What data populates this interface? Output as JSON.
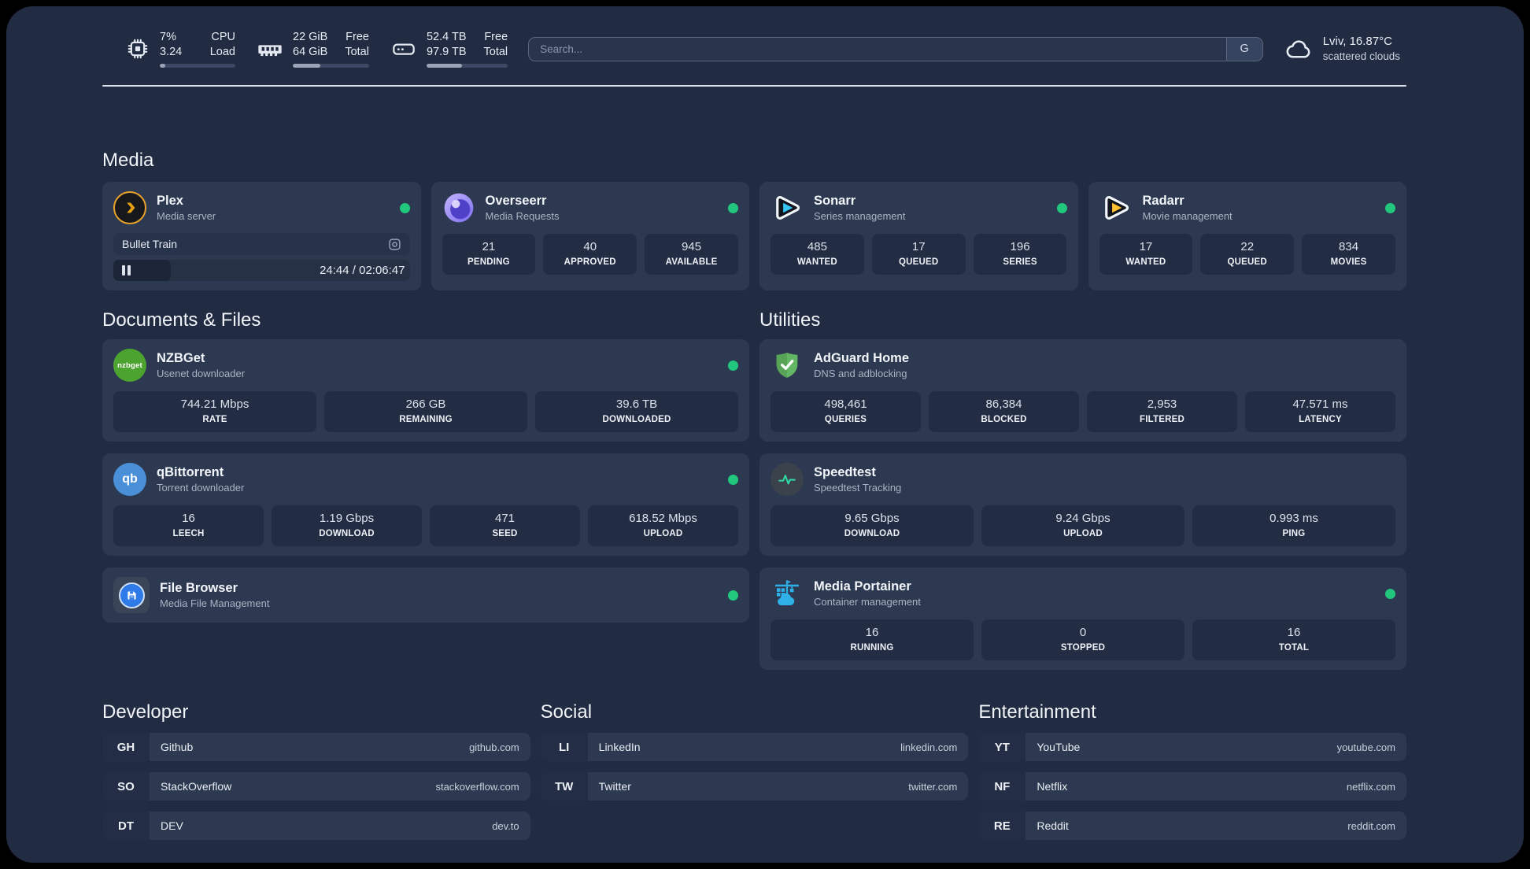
{
  "colors": {
    "page_bg": "#212b42",
    "card_bg": "#2c3950",
    "tile_bg": "#222c42",
    "status_online": "#21c77d",
    "plex_accent": "#e5a00d",
    "sonarr_accent": "#35c5f1",
    "radarr_accent": "#ffc230",
    "nzbget_accent": "#4da32f",
    "qbittorrent_accent": "#4a90d9",
    "filebrowser_accent": "#2e7ae8",
    "adguard_accent": "#63b663",
    "speedtest_accent": "#2ed9a3",
    "portainer_accent": "#2fb1e8"
  },
  "icons": {
    "cpu": "cpu-chip-icon",
    "memory": "ram-icon",
    "disk": "hard-drive-icon",
    "search_engine": "google-g",
    "weather": "cloud-icon",
    "plex": "plex-chevron-circle",
    "plex_session": "cast-icon",
    "plex_state": "pause-icon",
    "overseerr": "overseerr-eye-circle",
    "sonarr": "sonarr-play-triangle",
    "radarr": "radarr-play-triangle",
    "nzbget": "nzbget-green-circle",
    "qbittorrent": "qbittorrent-blue-circle",
    "filebrowser": "filebrowser-floppy-circle",
    "adguard": "adguard-shield-check",
    "speedtest": "speedtest-pulse",
    "portainer": "portainer-crane",
    "status": "online-dot"
  },
  "topbar": {
    "cpu": {
      "value_primary": "7%",
      "value_secondary": "3.24",
      "label_primary": "CPU",
      "label_secondary": "Load",
      "progress_percent": 7
    },
    "memory": {
      "value_primary": "22 GiB",
      "value_secondary": "64 GiB",
      "label_primary": "Free",
      "label_secondary": "Total",
      "progress_percent": 36
    },
    "disk": {
      "value_primary": "52.4 TB",
      "value_secondary": "97.9 TB",
      "label_primary": "Free",
      "label_secondary": "Total",
      "progress_percent": 44
    },
    "search": {
      "placeholder": "Search...",
      "button_label": "G"
    },
    "weather": {
      "location": "Lviv, 16.87°C",
      "condition": "scattered clouds"
    }
  },
  "media": {
    "title": "Media",
    "plex": {
      "name": "Plex",
      "subtitle": "Media server",
      "status": "online",
      "now_playing": {
        "title": "Bullet Train",
        "time": "24:44 / 02:06:47",
        "progress_percent": 19.5,
        "state": "paused"
      }
    },
    "overseerr": {
      "name": "Overseerr",
      "subtitle": "Media Requests",
      "status": "online",
      "stats": [
        {
          "value": "21",
          "label": "PENDING"
        },
        {
          "value": "40",
          "label": "APPROVED"
        },
        {
          "value": "945",
          "label": "AVAILABLE"
        }
      ]
    },
    "sonarr": {
      "name": "Sonarr",
      "subtitle": "Series management",
      "status": "online",
      "stats": [
        {
          "value": "485",
          "label": "WANTED"
        },
        {
          "value": "17",
          "label": "QUEUED"
        },
        {
          "value": "196",
          "label": "SERIES"
        }
      ]
    },
    "radarr": {
      "name": "Radarr",
      "subtitle": "Movie management",
      "status": "online",
      "stats": [
        {
          "value": "17",
          "label": "WANTED"
        },
        {
          "value": "22",
          "label": "QUEUED"
        },
        {
          "value": "834",
          "label": "MOVIES"
        }
      ]
    }
  },
  "documents": {
    "title": "Documents & Files",
    "nzbget": {
      "name": "NZBGet",
      "subtitle": "Usenet downloader",
      "status": "online",
      "icon_text": "nzbget",
      "stats": [
        {
          "value": "744.21 Mbps",
          "label": "RATE"
        },
        {
          "value": "266 GB",
          "label": "REMAINING"
        },
        {
          "value": "39.6 TB",
          "label": "DOWNLOADED"
        }
      ]
    },
    "qbittorrent": {
      "name": "qBittorrent",
      "subtitle": "Torrent downloader",
      "status": "online",
      "icon_text": "qb",
      "stats": [
        {
          "value": "16",
          "label": "LEECH"
        },
        {
          "value": "1.19 Gbps",
          "label": "DOWNLOAD"
        },
        {
          "value": "471",
          "label": "SEED"
        },
        {
          "value": "618.52 Mbps",
          "label": "UPLOAD"
        }
      ]
    },
    "filebrowser": {
      "name": "File Browser",
      "subtitle": "Media File Management",
      "status": "online"
    }
  },
  "utilities": {
    "title": "Utilities",
    "adguard": {
      "name": "AdGuard Home",
      "subtitle": "DNS and adblocking",
      "stats": [
        {
          "value": "498,461",
          "label": "QUERIES"
        },
        {
          "value": "86,384",
          "label": "BLOCKED"
        },
        {
          "value": "2,953",
          "label": "FILTERED"
        },
        {
          "value": "47.571 ms",
          "label": "LATENCY"
        }
      ]
    },
    "speedtest": {
      "name": "Speedtest",
      "subtitle": "Speedtest Tracking",
      "stats": [
        {
          "value": "9.65 Gbps",
          "label": "DOWNLOAD"
        },
        {
          "value": "9.24 Gbps",
          "label": "UPLOAD"
        },
        {
          "value": "0.993 ms",
          "label": "PING"
        }
      ]
    },
    "portainer": {
      "name": "Media Portainer",
      "subtitle": "Container management",
      "status": "online",
      "stats": [
        {
          "value": "16",
          "label": "RUNNING"
        },
        {
          "value": "0",
          "label": "STOPPED"
        },
        {
          "value": "16",
          "label": "TOTAL"
        }
      ]
    }
  },
  "bookmarks": [
    {
      "title": "Developer",
      "items": [
        {
          "abbr": "GH",
          "name": "Github",
          "url": "github.com"
        },
        {
          "abbr": "SO",
          "name": "StackOverflow",
          "url": "stackoverflow.com"
        },
        {
          "abbr": "DT",
          "name": "DEV",
          "url": "dev.to"
        }
      ]
    },
    {
      "title": "Social",
      "items": [
        {
          "abbr": "LI",
          "name": "LinkedIn",
          "url": "linkedin.com"
        },
        {
          "abbr": "TW",
          "name": "Twitter",
          "url": "twitter.com"
        }
      ]
    },
    {
      "title": "Entertainment",
      "items": [
        {
          "abbr": "YT",
          "name": "YouTube",
          "url": "youtube.com"
        },
        {
          "abbr": "NF",
          "name": "Netflix",
          "url": "netflix.com"
        },
        {
          "abbr": "RE",
          "name": "Reddit",
          "url": "reddit.com"
        }
      ]
    }
  ]
}
